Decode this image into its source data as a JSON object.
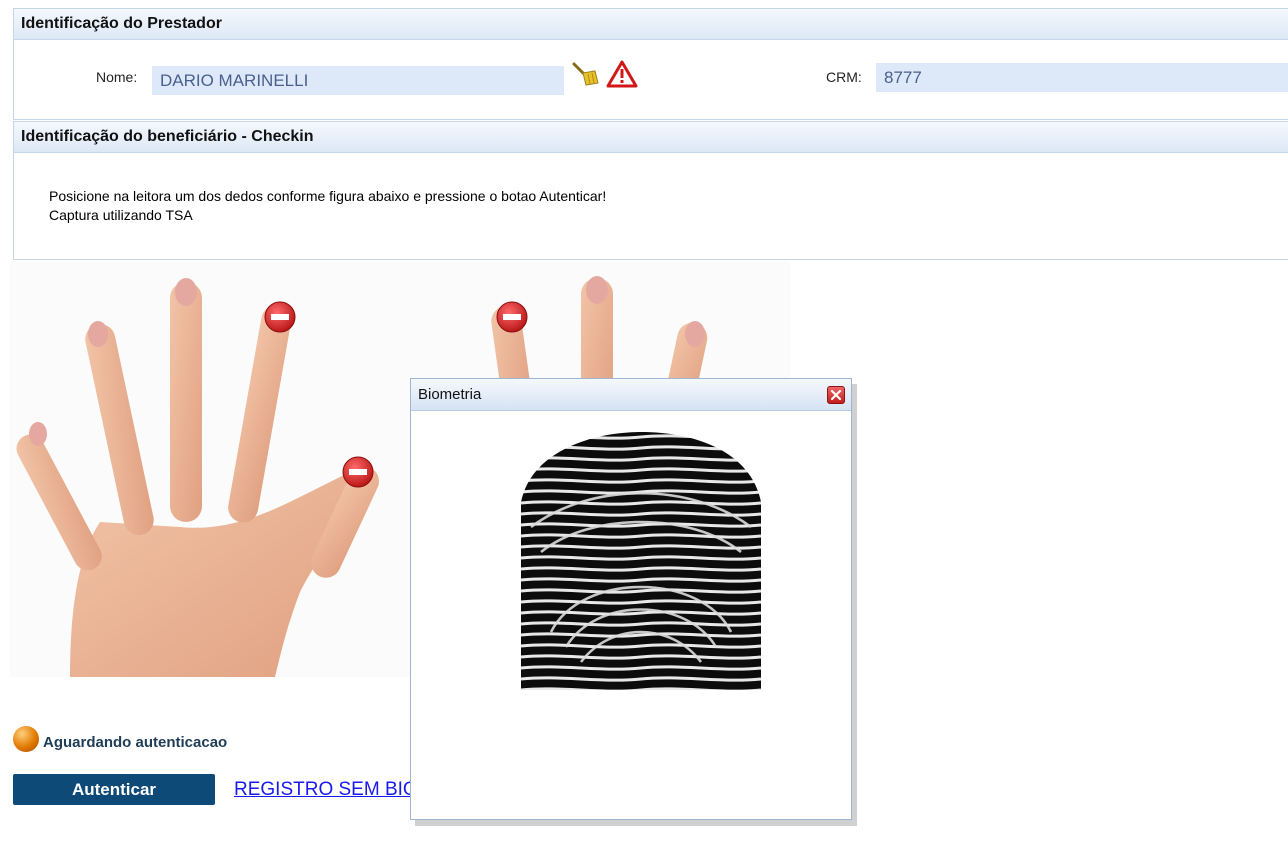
{
  "prestador": {
    "title": "Identificação do Prestador",
    "nome_label": "Nome:",
    "nome_value": "DARIO MARINELLI",
    "crm_label": "CRM:",
    "crm_value": "8777",
    "icons": [
      "broom-icon",
      "warning-icon"
    ]
  },
  "beneficiario": {
    "title": "Identificação do beneficiário - Checkin",
    "instruction_line1": "Posicione na leitora um dos dedos conforme figura abaixo e pressione o botao Autenticar!",
    "instruction_line2": "Captura utilizando TSA"
  },
  "dialog": {
    "title": "Biometria",
    "close_icon": "close-icon"
  },
  "status": {
    "text": "Aguardando autenticacao",
    "color": "#e07a00"
  },
  "actions": {
    "authenticate_label": "Autenticar",
    "register_link_label": "REGISTRO SEM BIOMETRIA"
  },
  "colors": {
    "header_bg": "#dde8f6",
    "input_bg": "#dde8f8",
    "button_bg": "#0e4a78",
    "link": "#1a1aee"
  }
}
